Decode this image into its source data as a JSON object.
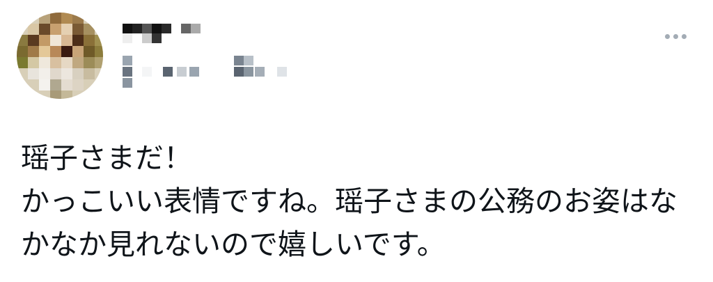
{
  "tweet": {
    "avatar_icon": "avatar-icon",
    "display_name_redacted": true,
    "handle_redacted": true,
    "more_icon": "more-options-icon",
    "body_lines": [
      "瑶子さまだ！",
      "かっこいい表情ですね。瑶子さまの公務のお姿はな",
      "かなか見れないので嬉しいです。"
    ]
  },
  "colors": {
    "text": "#0f1419",
    "muted": "#a3acb5",
    "background": "#ffffff"
  }
}
